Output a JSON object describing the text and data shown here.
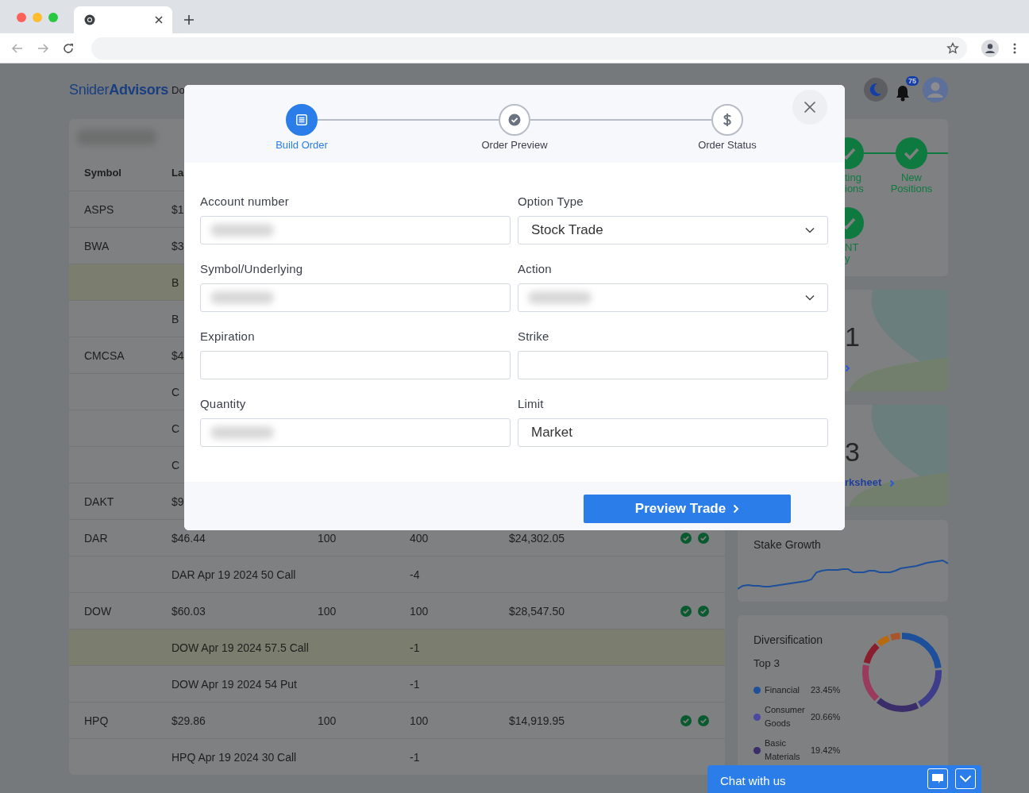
{
  "header": {
    "logo": "Snider**Advisors**",
    "page_title": "Do",
    "notification_count": "75"
  },
  "holdings": {
    "columns": [
      "Symbol",
      "La"
    ],
    "rows": [
      {
        "column_1": "ASPS",
        "column_2": "$1",
        "verified": false,
        "highlighted": false
      },
      {
        "column_1": "BWA",
        "column_2": "$3",
        "verified": false,
        "highlighted": false
      },
      {
        "column_2": "B",
        "verified": false,
        "highlighted": true
      },
      {
        "column_2": "B",
        "verified": false,
        "highlighted": false
      },
      {
        "column_1": "CMCSA",
        "column_2": "$4",
        "verified": false,
        "highlighted": false
      },
      {
        "column_2": "C",
        "verified": false,
        "highlighted": false
      },
      {
        "column_2": "C",
        "verified": false,
        "highlighted": false
      },
      {
        "column_2": "C",
        "verified": false,
        "highlighted": false
      },
      {
        "column_1": "DAKT",
        "column_2": "$9",
        "verified": false,
        "highlighted": false
      },
      {
        "column_1": "DAR",
        "column_2": "$46.44",
        "column_3": "100",
        "column_4": "400",
        "column_5": "$24,302.05",
        "verified": true,
        "highlighted": false
      },
      {
        "column_2": "DAR Apr 19 2024 50 Call",
        "column_4": "-4",
        "verified": false,
        "highlighted": false
      },
      {
        "column_1": "DOW",
        "column_2": "$60.03",
        "column_3": "100",
        "column_4": "100",
        "column_5": "$28,547.50",
        "verified": true,
        "highlighted": false
      },
      {
        "column_2": "DOW Apr 19 2024 57.5 Call",
        "column_4": "-1",
        "verified": false,
        "highlighted": true
      },
      {
        "column_2": "DOW Apr 19 2024 54 Put",
        "column_4": "-1",
        "verified": false,
        "highlighted": false
      },
      {
        "column_1": "HPQ",
        "column_2": "$29.86",
        "column_3": "100",
        "column_4": "100",
        "column_5": "$14,919.95",
        "verified": true,
        "highlighted": false
      },
      {
        "column_2": "HPQ Apr 19 2024 30 Call",
        "column_4": "-1",
        "verified": false,
        "highlighted": false
      }
    ]
  },
  "order_modal": {
    "steps": [
      {
        "label": "Build Order",
        "selected": true
      },
      {
        "label": "Order Preview",
        "selected": false
      },
      {
        "label": "Order Status",
        "selected": false
      }
    ],
    "fields": [
      {
        "label": "Account number",
        "kind": "text",
        "redacted": true
      },
      {
        "label": "Option Type",
        "kind": "select",
        "value": "Stock Trade",
        "redacted": false
      },
      {
        "label": "Symbol/Underlying",
        "kind": "text",
        "redacted": true
      },
      {
        "label": "Action",
        "kind": "select",
        "redacted": true
      },
      {
        "label": "Expiration",
        "kind": "text",
        "redacted": false
      },
      {
        "label": "Strike",
        "kind": "text",
        "redacted": false
      },
      {
        "label": "Quantity",
        "kind": "text",
        "redacted": true
      },
      {
        "label": "Limit",
        "kind": "text",
        "value": "Market",
        "redacted": false
      }
    ],
    "submit": "Preview Trade"
  },
  "progress_card": {
    "steps": [
      {
        "lines": [
          "ting",
          "ions"
        ]
      },
      {
        "lines": [
          "New",
          "Positions"
        ]
      },
      {
        "lines": [
          "NT",
          "y"
        ]
      }
    ]
  },
  "stat_cards": [
    {
      "value": "1"
    },
    {
      "value": "3",
      "link": "rksheet"
    }
  ],
  "stake_growth": {
    "title": "Stake Growth"
  },
  "diversification": {
    "title": "Diversification",
    "subtitle": "Top 3",
    "legend": [
      {
        "name": "Financial",
        "share": "23.45%",
        "color": "#1d4f9a"
      },
      {
        "name": "Consumer Goods",
        "share": "20.66%",
        "color": "#4a48a0"
      },
      {
        "name": "Basic Materials",
        "share": "19.42%",
        "color": "#3a2d6a"
      }
    ]
  },
  "chat": {
    "label": "Chat with us"
  }
}
